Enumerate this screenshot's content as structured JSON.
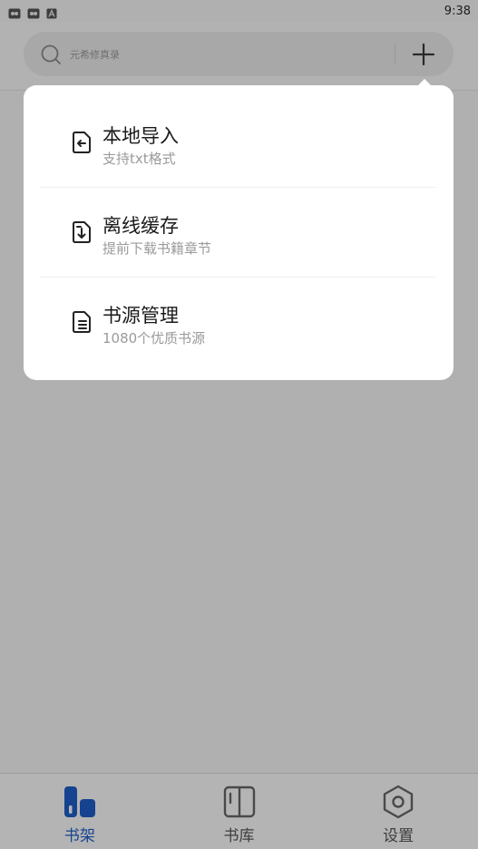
{
  "status_bar": {
    "time": "9:38",
    "icons": [
      "app-notification-icon",
      "app-notification-icon",
      "font-a-icon"
    ]
  },
  "header": {
    "search": {
      "placeholder": "元希修真录",
      "icon": "search-icon"
    },
    "add_button_icon": "plus-icon"
  },
  "popup_menu": {
    "items": [
      {
        "title": "本地导入",
        "subtitle": "支持txt格式",
        "icon": "file-import-icon"
      },
      {
        "title": "离线缓存",
        "subtitle": "提前下载书籍章节",
        "icon": "file-download-icon"
      },
      {
        "title": "书源管理",
        "subtitle": "1080个优质书源",
        "icon": "source-list-icon"
      }
    ]
  },
  "bottom_nav": {
    "items": [
      {
        "label": "书架",
        "icon": "bookshelf-icon",
        "active": true
      },
      {
        "label": "书库",
        "icon": "book-open-icon",
        "active": false
      },
      {
        "label": "设置",
        "icon": "settings-hexagon-icon",
        "active": false
      }
    ]
  },
  "colors": {
    "accent": "#1f5ec8",
    "overlay": "rgba(0,0,0,0.28)",
    "popup_bg": "#ffffff"
  }
}
